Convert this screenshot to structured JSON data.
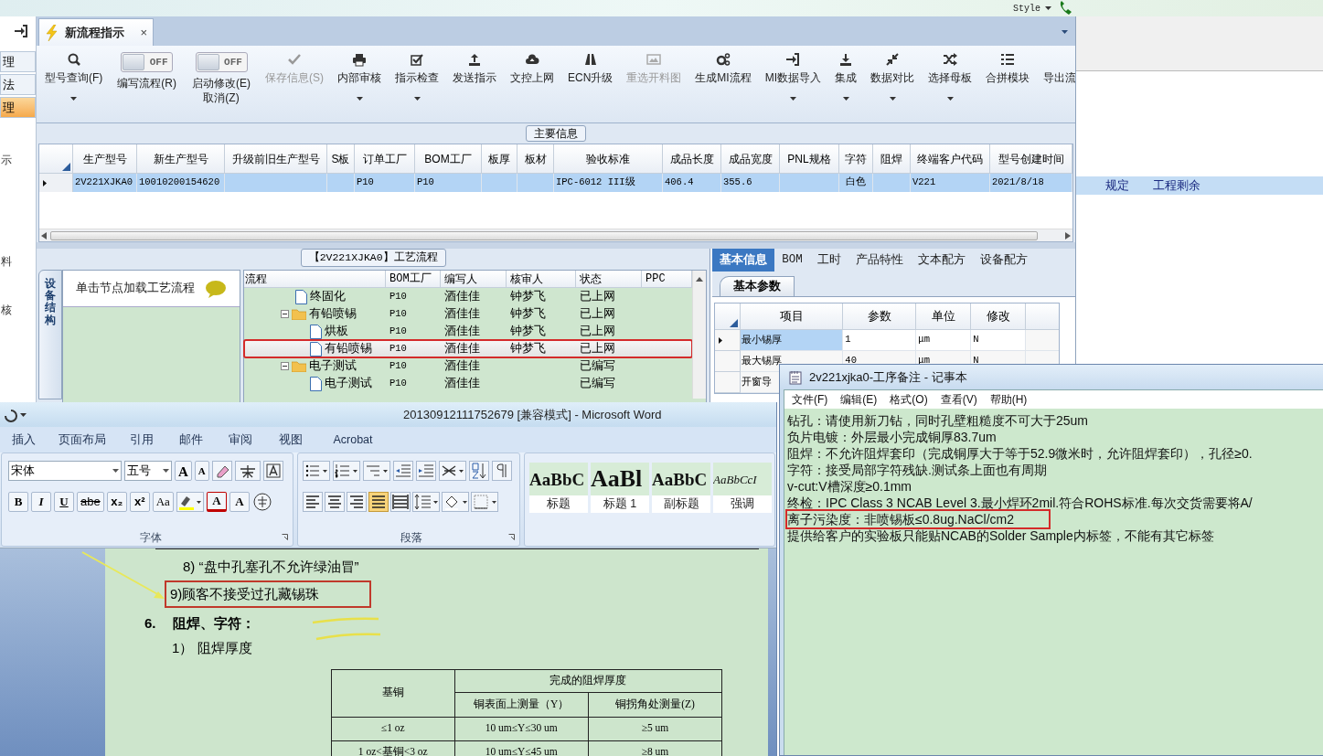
{
  "top_bar": {
    "style_menu": "Style"
  },
  "sidebar": {
    "items": [
      {
        "label": "理",
        "selected": false
      },
      {
        "label": "法",
        "selected": false
      },
      {
        "label": "理",
        "selected": true
      }
    ],
    "labels": [
      "示",
      "料",
      "核"
    ]
  },
  "tab": {
    "label": "新流程指示",
    "close": "×"
  },
  "toolbar": [
    {
      "kind": "button",
      "label": "型号查询(F)",
      "disabled": false,
      "dropdown": true
    },
    {
      "kind": "toggle",
      "label": "编写流程(R)",
      "switch_text": "OFF",
      "on": false
    },
    {
      "kind": "toggle",
      "label": "启动修改(E)",
      "sublabel": "取消(Z)",
      "switch_text": "OFF",
      "on": false
    },
    {
      "kind": "button",
      "label": "保存信息(S)",
      "disabled": true,
      "dropdown": false
    },
    {
      "kind": "button",
      "label": "内部审核",
      "disabled": false,
      "dropdown": true
    },
    {
      "kind": "button",
      "label": "指示检查",
      "disabled": false,
      "dropdown": true
    },
    {
      "kind": "button",
      "label": "发送指示",
      "disabled": false,
      "dropdown": false
    },
    {
      "kind": "button",
      "label": "文控上网",
      "disabled": false,
      "dropdown": false
    },
    {
      "kind": "button",
      "label": "ECN升级",
      "disabled": false,
      "dropdown": false
    },
    {
      "kind": "button",
      "label": "重选开料图",
      "disabled": true,
      "dropdown": false
    },
    {
      "kind": "button",
      "label": "生成MI流程",
      "disabled": false,
      "dropdown": false
    },
    {
      "kind": "button",
      "label": "MI数据导入",
      "disabled": false,
      "dropdown": true
    },
    {
      "kind": "button",
      "label": "集成",
      "disabled": false,
      "dropdown": true
    },
    {
      "kind": "button",
      "label": "数据对比",
      "disabled": false,
      "dropdown": true
    },
    {
      "kind": "button",
      "label": "选择母板",
      "disabled": false,
      "dropdown": true
    },
    {
      "kind": "button",
      "label": "合拼模块",
      "disabled": false,
      "dropdown": false
    },
    {
      "kind": "button",
      "label": "导出流",
      "disabled": false,
      "dropdown": false
    }
  ],
  "main_info": {
    "title": "主要信息",
    "columns": [
      "生产型号",
      "新生产型号",
      "升级前旧生产型号",
      "S板",
      "订单工厂",
      "BOM工厂",
      "板厚",
      "板材",
      "验收标准",
      "成品长度",
      "成品宽度",
      "PNL规格",
      "字符",
      "阻焊",
      "终端客户代码",
      "型号创建时间"
    ],
    "rows": [
      {
        "selected": true,
        "cells": [
          "2V221XJKA0",
          "10010200154620",
          null,
          null,
          "P10",
          "P10",
          null,
          null,
          "IPC-6012 III级",
          "406.4",
          "355.6",
          null,
          "白色",
          null,
          "V221",
          "2021/8/18"
        ]
      }
    ]
  },
  "flow": {
    "title": "【2V221XJKA0】工艺流程",
    "side_tab": "设备结构",
    "hint": "单击节点加载工艺流程",
    "columns": [
      "流程",
      "BOM工厂",
      "编写人",
      "核审人",
      "状态",
      "PPC"
    ],
    "rows": [
      {
        "kind": "file",
        "label": "终固化",
        "bom": "P10",
        "writer": "酒佳佳",
        "reviewer": "钟梦飞",
        "status": "已上网",
        "selected": false,
        "highlighted": false
      },
      {
        "kind": "folder",
        "label": "有铅喷锡",
        "bom": "P10",
        "writer": "酒佳佳",
        "reviewer": "钟梦飞",
        "status": "已上网",
        "selected": false,
        "highlighted": false,
        "expanded": true,
        "children": [
          {
            "kind": "file",
            "label": "烘板",
            "bom": "P10",
            "writer": "酒佳佳",
            "reviewer": "钟梦飞",
            "status": "已上网",
            "selected": false,
            "highlighted": false
          },
          {
            "kind": "file",
            "label": "有铅喷锡",
            "bom": "P10",
            "writer": "酒佳佳",
            "reviewer": "钟梦飞",
            "status": "已上网",
            "selected": true,
            "highlighted": true
          }
        ]
      },
      {
        "kind": "folder",
        "label": "电子测试",
        "bom": "P10",
        "writer": "酒佳佳",
        "status": "已编写",
        "selected": false,
        "highlighted": false,
        "expanded": true,
        "children": [
          {
            "kind": "file",
            "label": "电子测试",
            "bom": "P10",
            "writer": "酒佳佳",
            "status": "已编写",
            "selected": false,
            "highlighted": false
          }
        ]
      }
    ]
  },
  "basic_info": {
    "tabs": [
      {
        "label": "基本信息",
        "selected": true
      },
      {
        "label": "BOM",
        "selected": false
      },
      {
        "label": "工时",
        "selected": false
      },
      {
        "label": "产品特性",
        "selected": false
      },
      {
        "label": "文本配方",
        "selected": false
      },
      {
        "label": "设备配方",
        "selected": false
      }
    ],
    "subtab": "基本参数",
    "columns": [
      "项目",
      "参数",
      "单位",
      "修改"
    ],
    "rows": [
      {
        "selected": true,
        "cells": [
          "最小锡厚",
          "1",
          "μm",
          "N"
        ]
      },
      {
        "selected": false,
        "cells": [
          "最大锡厚",
          "40",
          "μm",
          "N"
        ]
      },
      {
        "selected": false,
        "cells": [
          "开窗导"
        ]
      }
    ]
  },
  "side_panel": {
    "cells": [
      "规定",
      "工程剩余"
    ]
  },
  "word": {
    "title": "20130912111752679 [兼容模式] - Microsoft Word",
    "ribbon_tabs": [
      "插入",
      "页面布局",
      "引用",
      "邮件",
      "审阅",
      "视图",
      "Acrobat"
    ],
    "font_name": "宋体",
    "font_size": "五号",
    "size_buttons": [
      {
        "label": "A",
        "kind": "grow"
      },
      {
        "label": "A",
        "kind": "shrink"
      }
    ],
    "format_buttons": [
      {
        "label": "B",
        "kind": "bold"
      },
      {
        "label": "I",
        "kind": "italic"
      },
      {
        "label": "U",
        "kind": "underline"
      },
      {
        "label": "abe",
        "kind": "strike"
      },
      {
        "label": "x₂",
        "kind": "sub"
      },
      {
        "label": "x²",
        "kind": "sup"
      },
      {
        "label": "Aa",
        "kind": "case"
      },
      {
        "label": "A",
        "kind": "font-color"
      },
      {
        "label": "A",
        "kind": "shading"
      }
    ],
    "font_group": "字体",
    "paragraph_group": "段落",
    "align_buttons": [
      {
        "selected": false
      },
      {
        "selected": false
      },
      {
        "selected": false
      },
      {
        "selected": true
      },
      {
        "selected": false
      }
    ],
    "styles": [
      {
        "kind": "title",
        "preview": "AaBbC",
        "label": "标题"
      },
      {
        "kind": "heading",
        "preview": "AaBl",
        "label": "标题 1"
      },
      {
        "kind": "subtitle",
        "preview": "AaBbC",
        "label": "副标题"
      },
      {
        "kind": "emphasis",
        "preview": "AaBbCcI",
        "label": "强调"
      }
    ],
    "doc": [
      {
        "kind": "item",
        "text": "8) “盘中孔塞孔不允许绿油冒”",
        "highlighted": false
      },
      {
        "kind": "item",
        "text": "9)顾客不接受过孔藏锡珠",
        "highlighted": true
      },
      {
        "kind": "heading",
        "number": "6.",
        "text": "阻焊、字符：",
        "highlighted": false
      },
      {
        "kind": "item",
        "text": "1） 阻焊厚度",
        "highlighted": false
      }
    ],
    "table": {
      "corner": "基铜",
      "group_header": "完成的阻焊厚度",
      "sub_headers": [
        "铜表面上测量（Y）",
        "铜拐角处测量(Z)"
      ],
      "rows": [
        [
          "≤1 oz",
          "10 um≤Y≤30 um",
          "≥5 um"
        ],
        [
          "1 oz<基铜<3 oz",
          "10 um≤Y≤45 um",
          "≥8 um"
        ]
      ]
    }
  },
  "notepad": {
    "title": "2v221xjka0-工序备注 - 记事本",
    "menu": [
      "文件(F)",
      "编辑(E)",
      "格式(O)",
      "查看(V)",
      "帮助(H)"
    ],
    "lines": [
      {
        "text": "钻孔：请使用新刀钻，同时孔壁粗糙度不可大于25um",
        "highlighted": false
      },
      {
        "text": "负片电镀：外层最小完成铜厚83.7um",
        "highlighted": false
      },
      {
        "text": "阻焊：不允许阻焊套印（完成铜厚大于等于52.9微米时，允许阻焊套印），孔径≥0.",
        "highlighted": false
      },
      {
        "text": "字符：接受局部字符残缺.测试条上面也有周期",
        "highlighted": false
      },
      {
        "text": "v-cut:V槽深度≥0.1mm",
        "highlighted": false
      },
      {
        "text": "终检：IPC Class 3 NCAB Level 3.最小焊环2mil.符合ROHS标准.每次交货需要将A/",
        "highlighted": false
      },
      {
        "text": "离子污染度：非喷锡板≤0.8ug.NaCl/cm2",
        "highlighted": true
      },
      {
        "text": "提供给客户的实验板只能贴NCAB的Solder Sample内标签，不能有其它标签",
        "highlighted": false
      }
    ]
  }
}
